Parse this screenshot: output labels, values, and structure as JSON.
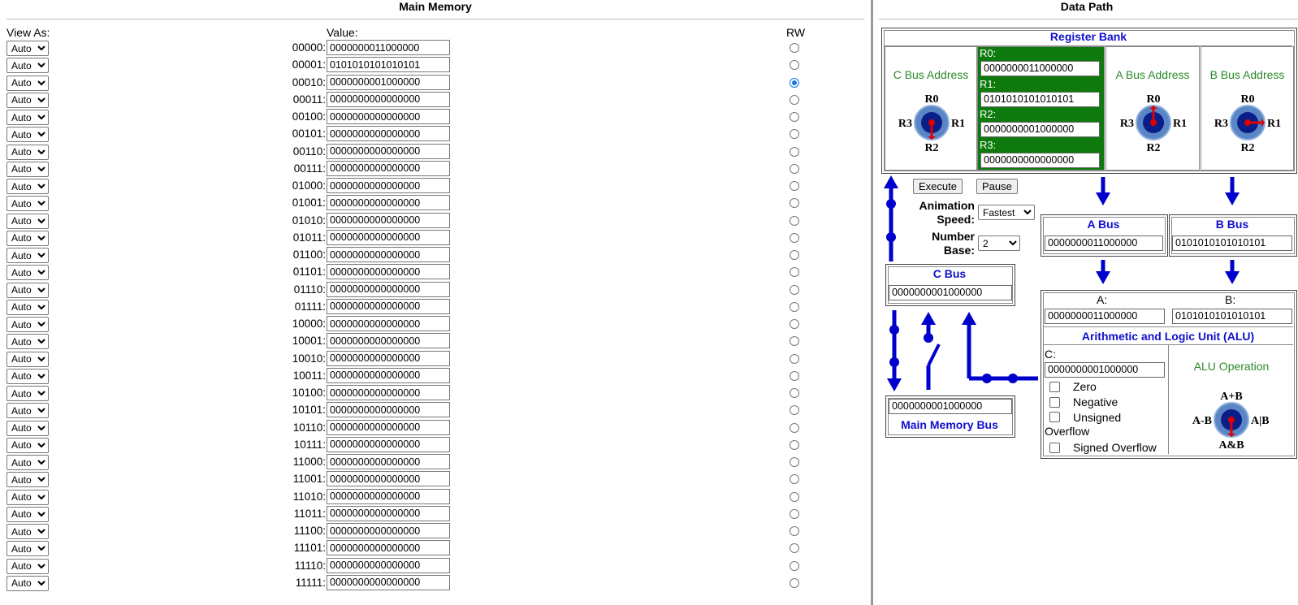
{
  "main_memory": {
    "title": "Main Memory",
    "view_as_label": "View As:",
    "value_label": "Value:",
    "rw_label": "RW",
    "view_as_option": "Auto",
    "rows": [
      {
        "addr": "00000:",
        "value": "0000000011000000",
        "selected": false
      },
      {
        "addr": "00001:",
        "value": "0101010101010101",
        "selected": false
      },
      {
        "addr": "00010:",
        "value": "0000000001000000",
        "selected": true
      },
      {
        "addr": "00011:",
        "value": "0000000000000000",
        "selected": false
      },
      {
        "addr": "00100:",
        "value": "0000000000000000",
        "selected": false
      },
      {
        "addr": "00101:",
        "value": "0000000000000000",
        "selected": false
      },
      {
        "addr": "00110:",
        "value": "0000000000000000",
        "selected": false
      },
      {
        "addr": "00111:",
        "value": "0000000000000000",
        "selected": false
      },
      {
        "addr": "01000:",
        "value": "0000000000000000",
        "selected": false
      },
      {
        "addr": "01001:",
        "value": "0000000000000000",
        "selected": false
      },
      {
        "addr": "01010:",
        "value": "0000000000000000",
        "selected": false
      },
      {
        "addr": "01011:",
        "value": "0000000000000000",
        "selected": false
      },
      {
        "addr": "01100:",
        "value": "0000000000000000",
        "selected": false
      },
      {
        "addr": "01101:",
        "value": "0000000000000000",
        "selected": false
      },
      {
        "addr": "01110:",
        "value": "0000000000000000",
        "selected": false
      },
      {
        "addr": "01111:",
        "value": "0000000000000000",
        "selected": false
      },
      {
        "addr": "10000:",
        "value": "0000000000000000",
        "selected": false
      },
      {
        "addr": "10001:",
        "value": "0000000000000000",
        "selected": false
      },
      {
        "addr": "10010:",
        "value": "0000000000000000",
        "selected": false
      },
      {
        "addr": "10011:",
        "value": "0000000000000000",
        "selected": false
      },
      {
        "addr": "10100:",
        "value": "0000000000000000",
        "selected": false
      },
      {
        "addr": "10101:",
        "value": "0000000000000000",
        "selected": false
      },
      {
        "addr": "10110:",
        "value": "0000000000000000",
        "selected": false
      },
      {
        "addr": "10111:",
        "value": "0000000000000000",
        "selected": false
      },
      {
        "addr": "11000:",
        "value": "0000000000000000",
        "selected": false
      },
      {
        "addr": "11001:",
        "value": "0000000000000000",
        "selected": false
      },
      {
        "addr": "11010:",
        "value": "0000000000000000",
        "selected": false
      },
      {
        "addr": "11011:",
        "value": "0000000000000000",
        "selected": false
      },
      {
        "addr": "11100:",
        "value": "0000000000000000",
        "selected": false
      },
      {
        "addr": "11101:",
        "value": "0000000000000000",
        "selected": false
      },
      {
        "addr": "11110:",
        "value": "0000000000000000",
        "selected": false
      },
      {
        "addr": "11111:",
        "value": "0000000000000000",
        "selected": false
      }
    ]
  },
  "data_path": {
    "title": "Data Path",
    "register_bank": {
      "title": "Register Bank",
      "c_bus_address": "C Bus Address",
      "a_bus_address": "A Bus Address",
      "b_bus_address": "B Bus Address",
      "registers": [
        {
          "label": "R0:",
          "value": "0000000011000000"
        },
        {
          "label": "R1:",
          "value": "0101010101010101"
        },
        {
          "label": "R2:",
          "value": "0000000001000000"
        },
        {
          "label": "R3:",
          "value": "0000000000000000"
        }
      ],
      "dial_labels": {
        "top": "R0",
        "right": "R1",
        "bottom": "R2",
        "left": "R3"
      }
    },
    "controls": {
      "execute": "Execute",
      "pause": "Pause",
      "animation_speed_label_1": "Animation",
      "animation_speed_label_2": "Speed:",
      "animation_speed_value": "Fastest",
      "number_base_label_1": "Number",
      "number_base_label_2": "Base:",
      "number_base_value": "2"
    },
    "a_bus": {
      "title": "A Bus",
      "value": "0000000011000000"
    },
    "b_bus": {
      "title": "B Bus",
      "value": "0101010101010101"
    },
    "c_bus": {
      "title": "C Bus",
      "value": "0000000001000000"
    },
    "main_memory_bus": {
      "title": "Main Memory Bus",
      "value": "0000000001000000"
    },
    "alu": {
      "title": "Arithmetic and Logic Unit (ALU)",
      "a_label": "A:",
      "a_value": "0000000011000000",
      "b_label": "B:",
      "b_value": "0101010101010101",
      "c_label": "C:",
      "c_value": "0000000001000000",
      "operation_label": "ALU Operation",
      "flags": {
        "zero": "Zero",
        "negative": "Negative",
        "unsigned": "Unsigned",
        "overflow": "Overflow",
        "signed_overflow": "Signed Overflow"
      },
      "dial_labels": {
        "top": "A+B",
        "right": "A|B",
        "bottom": "A&B",
        "left": "A-B"
      }
    },
    "colors": {
      "bus_blue": "#0000cc",
      "register_green": "#0e7a0e",
      "title_blue": "#1010cc",
      "label_green": "#2a8a2a",
      "pointer_red": "#e00000"
    }
  }
}
